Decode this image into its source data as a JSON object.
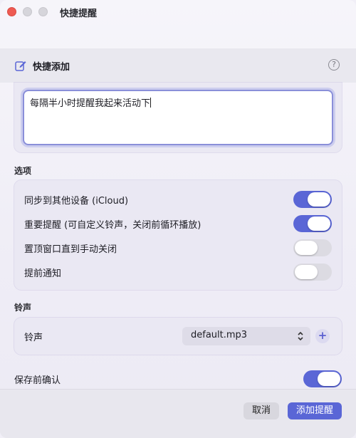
{
  "window": {
    "title": "快捷提醒"
  },
  "section": {
    "title": "快捷添加",
    "help": "?"
  },
  "input": {
    "value": "每隔半小时提醒我起来活动下"
  },
  "options": {
    "label": "选项",
    "items": [
      {
        "label": "同步到其他设备 (iCloud)",
        "on": true
      },
      {
        "label": "重要提醒 (可自定义铃声，关闭前循环播放)",
        "on": true
      },
      {
        "label": "置顶窗口直到手动关闭",
        "on": false
      },
      {
        "label": "提前通知",
        "on": false
      }
    ]
  },
  "ringtone": {
    "group_label": "铃声",
    "label": "铃声",
    "selected": "default.mp3",
    "add": "+"
  },
  "confirm": {
    "label": "保存前确认",
    "on": true
  },
  "footer": {
    "cancel": "取消",
    "add": "添加提醒"
  },
  "colors": {
    "accent": "#5a66d6",
    "toggle_off": "#dcdbe2",
    "close": "#ee5a52"
  }
}
